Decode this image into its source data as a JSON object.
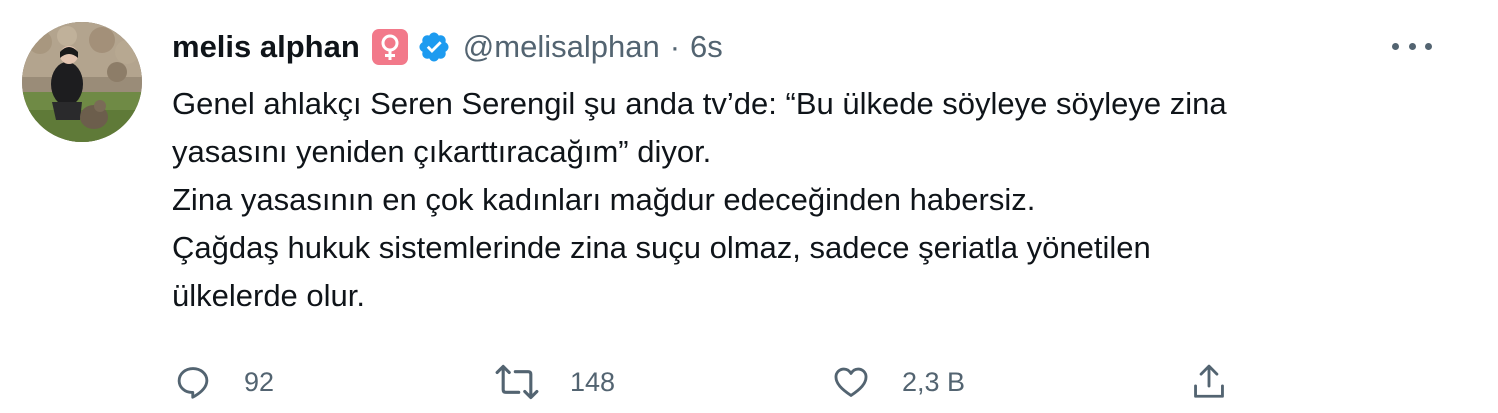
{
  "tweet": {
    "display_name": "melis alphan",
    "emoji_badge": "female-sign",
    "verified": true,
    "handle": "@melisalphan",
    "separator": "·",
    "time": "6s",
    "lines": [
      "Genel ahlakçı Seren Serengil şu anda tv’de: “Bu ülkede söyleye söyleye zina",
      "yasasını yeniden çıkarttıracağım” diyor.",
      "Zina yasasının en çok kadınları mağdur edeceğinden habersiz.",
      "Çağdaş hukuk sistemlerinde zina suçu olmaz, sadece şeriatla yönetilen",
      "ülkelerde olur."
    ]
  },
  "actions": {
    "reply_count": "92",
    "retweet_count": "148",
    "like_count": "2,3 B"
  },
  "icons": {
    "reply": "reply-icon",
    "retweet": "retweet-icon",
    "like": "heart-icon",
    "share": "share-icon",
    "more": "more-icon",
    "verified": "verified-badge-icon"
  },
  "colors": {
    "text": "#0f1419",
    "secondary": "#536471",
    "verified_blue": "#1d9bf0",
    "badge_pink": "#f2798a"
  }
}
